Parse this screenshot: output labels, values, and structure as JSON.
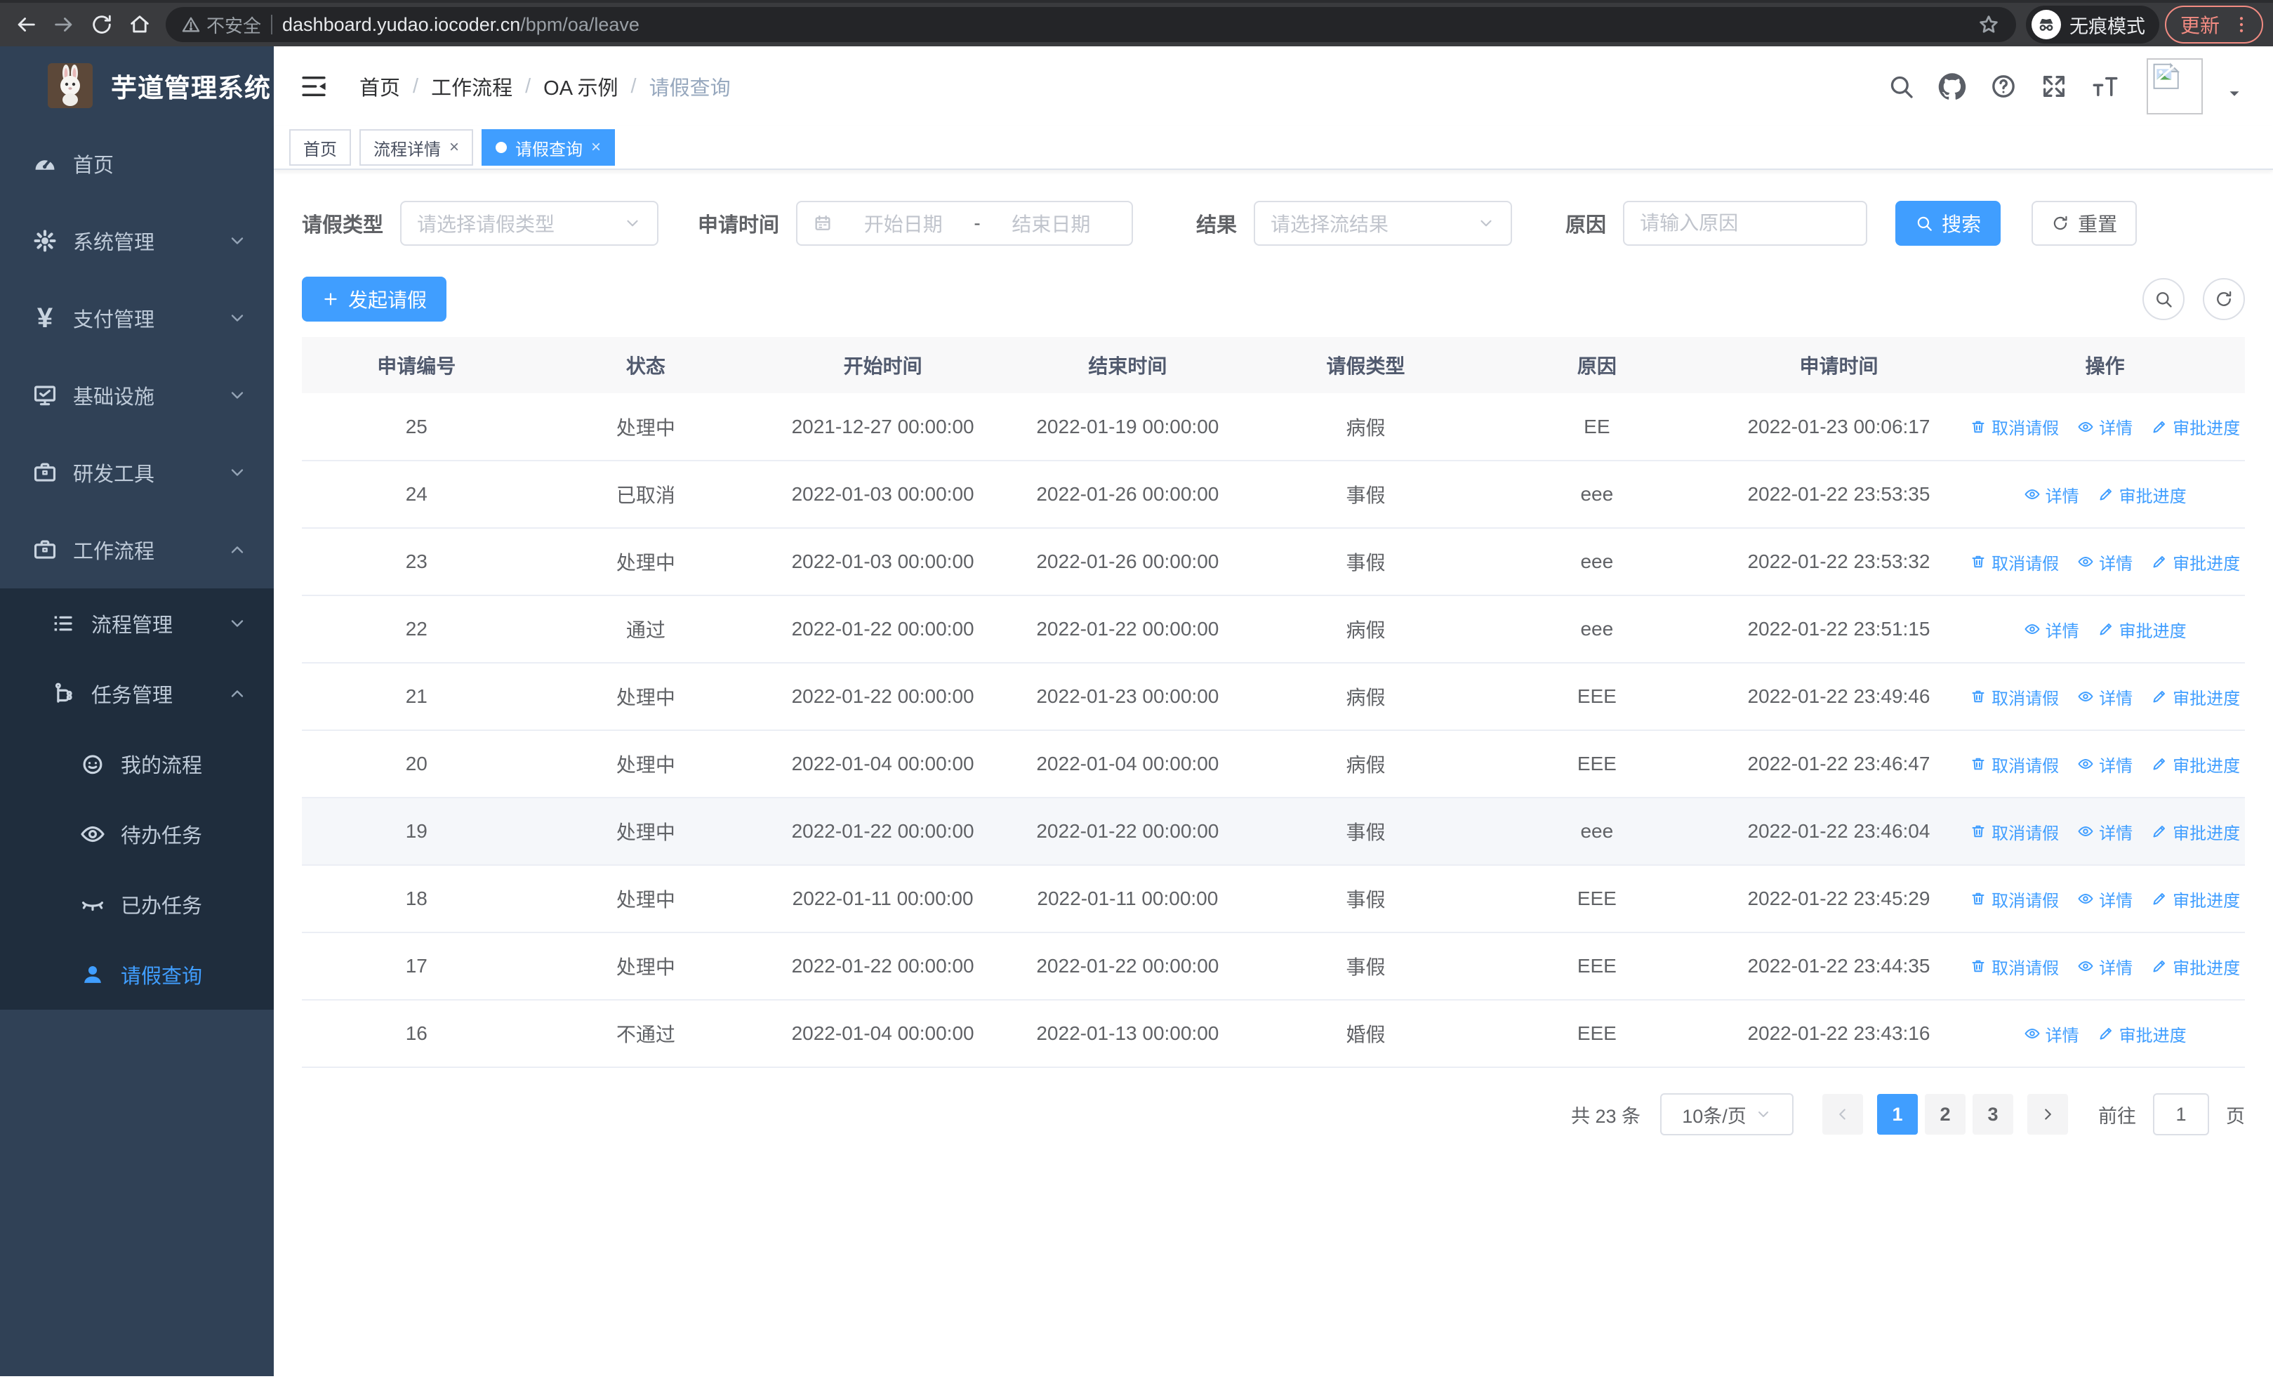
{
  "browser": {
    "security_label": "不安全",
    "url_host": "dashboard.yudao.iocoder.cn",
    "url_path": "/bpm/oa/leave",
    "incognito_label": "无痕模式",
    "update_label": "更新"
  },
  "sidebar": {
    "title": "芋道管理系统",
    "menu": [
      {
        "label": "首页",
        "icon": "gauge",
        "level": 1,
        "sub": false,
        "chevron": null,
        "active": false
      },
      {
        "label": "系统管理",
        "icon": "gear",
        "level": 1,
        "sub": false,
        "chevron": "down",
        "active": false
      },
      {
        "label": "支付管理",
        "icon": "yen",
        "level": 1,
        "sub": false,
        "chevron": "down",
        "active": false
      },
      {
        "label": "基础设施",
        "icon": "monitor",
        "level": 1,
        "sub": false,
        "chevron": "down",
        "active": false
      },
      {
        "label": "研发工具",
        "icon": "briefcase",
        "level": 1,
        "sub": false,
        "chevron": "down",
        "active": false
      },
      {
        "label": "工作流程",
        "icon": "briefcase",
        "level": 1,
        "sub": false,
        "chevron": "up",
        "active": false
      },
      {
        "label": "流程管理",
        "icon": "list",
        "level": 2,
        "sub": true,
        "chevron": "down",
        "active": false
      },
      {
        "label": "任务管理",
        "icon": "tree",
        "level": 2,
        "sub": true,
        "chevron": "up",
        "active": false
      },
      {
        "label": "我的流程",
        "icon": "robot",
        "level": 3,
        "sub": true,
        "chevron": null,
        "active": false
      },
      {
        "label": "待办任务",
        "icon": "eye",
        "level": 3,
        "sub": true,
        "chevron": null,
        "active": false
      },
      {
        "label": "已办任务",
        "icon": "eye-closed",
        "level": 3,
        "sub": true,
        "chevron": null,
        "active": false
      },
      {
        "label": "请假查询",
        "icon": "user",
        "level": 3,
        "sub": true,
        "chevron": null,
        "active": true
      }
    ]
  },
  "navbar": {
    "breadcrumb": [
      "首页",
      "工作流程",
      "OA 示例",
      "请假查询"
    ]
  },
  "tabs": [
    {
      "label": "首页",
      "closable": false,
      "active": false
    },
    {
      "label": "流程详情",
      "closable": true,
      "active": false
    },
    {
      "label": "请假查询",
      "closable": true,
      "active": true
    }
  ],
  "filters": {
    "leave_type": {
      "label": "请假类型",
      "placeholder": "请选择请假类型"
    },
    "apply_time": {
      "label": "申请时间",
      "start_placeholder": "开始日期",
      "separator": "-",
      "end_placeholder": "结束日期"
    },
    "result": {
      "label": "结果",
      "placeholder": "请选择流结果"
    },
    "reason": {
      "label": "原因",
      "placeholder": "请输入原因"
    },
    "search_label": "搜索",
    "reset_label": "重置"
  },
  "toolbar": {
    "create_label": "发起请假"
  },
  "table": {
    "columns": [
      "申请编号",
      "状态",
      "开始时间",
      "结束时间",
      "请假类型",
      "原因",
      "申请时间",
      "操作"
    ],
    "action_defs": {
      "cancel": {
        "label": "取消请假",
        "icon": "trash"
      },
      "detail": {
        "label": "详情",
        "icon": "eye"
      },
      "progress": {
        "label": "审批进度",
        "icon": "edit"
      }
    },
    "rows": [
      {
        "id": "25",
        "status": "处理中",
        "start": "2021-12-27 00:00:00",
        "end": "2022-01-19 00:00:00",
        "type": "病假",
        "reason": "EE",
        "apply": "2022-01-23 00:06:17",
        "actions": [
          "cancel",
          "detail",
          "progress"
        ],
        "highlight": false
      },
      {
        "id": "24",
        "status": "已取消",
        "start": "2022-01-03 00:00:00",
        "end": "2022-01-26 00:00:00",
        "type": "事假",
        "reason": "eee",
        "apply": "2022-01-22 23:53:35",
        "actions": [
          "detail",
          "progress"
        ],
        "highlight": false
      },
      {
        "id": "23",
        "status": "处理中",
        "start": "2022-01-03 00:00:00",
        "end": "2022-01-26 00:00:00",
        "type": "事假",
        "reason": "eee",
        "apply": "2022-01-22 23:53:32",
        "actions": [
          "cancel",
          "detail",
          "progress"
        ],
        "highlight": false
      },
      {
        "id": "22",
        "status": "通过",
        "start": "2022-01-22 00:00:00",
        "end": "2022-01-22 00:00:00",
        "type": "病假",
        "reason": "eee",
        "apply": "2022-01-22 23:51:15",
        "actions": [
          "detail",
          "progress"
        ],
        "highlight": false
      },
      {
        "id": "21",
        "status": "处理中",
        "start": "2022-01-22 00:00:00",
        "end": "2022-01-23 00:00:00",
        "type": "病假",
        "reason": "EEE",
        "apply": "2022-01-22 23:49:46",
        "actions": [
          "cancel",
          "detail",
          "progress"
        ],
        "highlight": false
      },
      {
        "id": "20",
        "status": "处理中",
        "start": "2022-01-04 00:00:00",
        "end": "2022-01-04 00:00:00",
        "type": "病假",
        "reason": "EEE",
        "apply": "2022-01-22 23:46:47",
        "actions": [
          "cancel",
          "detail",
          "progress"
        ],
        "highlight": false
      },
      {
        "id": "19",
        "status": "处理中",
        "start": "2022-01-22 00:00:00",
        "end": "2022-01-22 00:00:00",
        "type": "事假",
        "reason": "eee",
        "apply": "2022-01-22 23:46:04",
        "actions": [
          "cancel",
          "detail",
          "progress"
        ],
        "highlight": true
      },
      {
        "id": "18",
        "status": "处理中",
        "start": "2022-01-11 00:00:00",
        "end": "2022-01-11 00:00:00",
        "type": "事假",
        "reason": "EEE",
        "apply": "2022-01-22 23:45:29",
        "actions": [
          "cancel",
          "detail",
          "progress"
        ],
        "highlight": false
      },
      {
        "id": "17",
        "status": "处理中",
        "start": "2022-01-22 00:00:00",
        "end": "2022-01-22 00:00:00",
        "type": "事假",
        "reason": "EEE",
        "apply": "2022-01-22 23:44:35",
        "actions": [
          "cancel",
          "detail",
          "progress"
        ],
        "highlight": false
      },
      {
        "id": "16",
        "status": "不通过",
        "start": "2022-01-04 00:00:00",
        "end": "2022-01-13 00:00:00",
        "type": "婚假",
        "reason": "EEE",
        "apply": "2022-01-22 23:43:16",
        "actions": [
          "detail",
          "progress"
        ],
        "highlight": false
      }
    ]
  },
  "pagination": {
    "total_label": "共 23 条",
    "page_size_label": "10条/页",
    "pages": [
      "1",
      "2",
      "3"
    ],
    "active_page": "1",
    "goto_label": "前往",
    "goto_value": "1",
    "unit_label": "页"
  },
  "colors": {
    "primary": "#409eff",
    "sidebar_bg": "#304156",
    "submenu_bg": "#1f2d3d",
    "sidebar_text": "#bfcbd9",
    "table_header_text": "#515a6e",
    "cell_text": "#606266",
    "update_accent": "#f28b82"
  }
}
